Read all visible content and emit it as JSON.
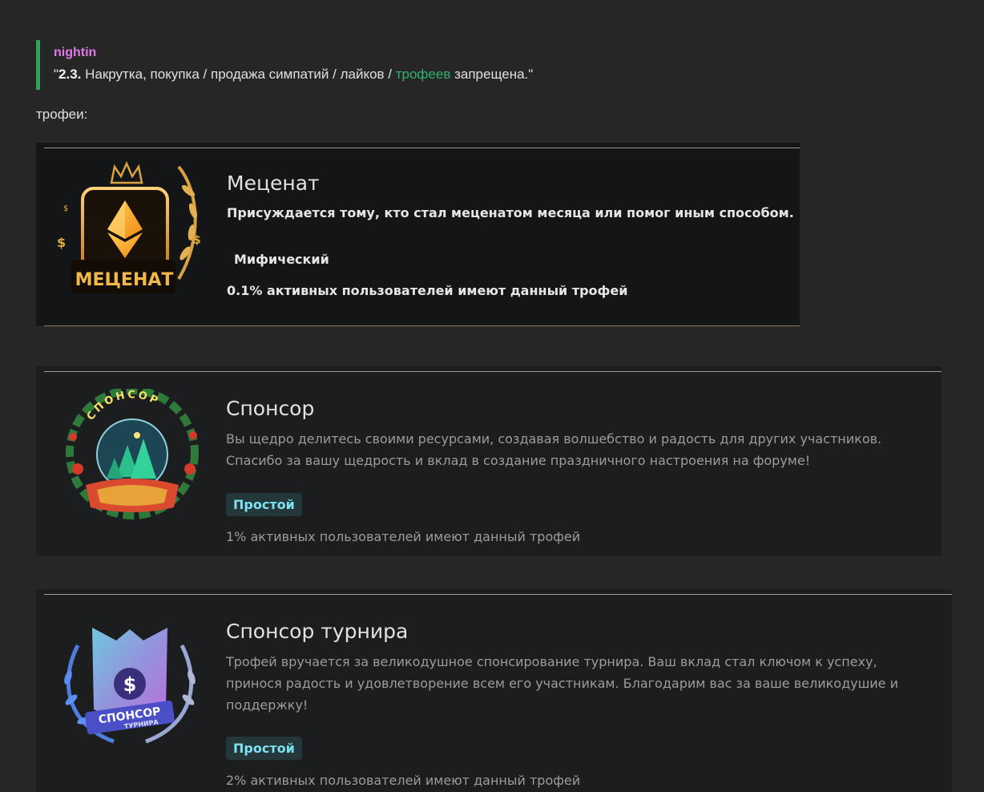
{
  "quote": {
    "author": "nightin",
    "open_quote": "\"",
    "rule_number": "2.3.",
    "text_before": " Накрутка, покупка / продажа симпатий / лайков / ",
    "link": "трофеев",
    "text_after": " запрещена.\""
  },
  "trophies_label": "трофеи:",
  "trophies": [
    {
      "title": "Меценат",
      "description": "Присуждается тому, кто стал меценатом месяца или помог иным способом.",
      "rarity": "Мифический",
      "stat": "0.1% активных пользователей имеют данный трофей",
      "badge_text": "МЕЦЕНАТ",
      "icon": "patron-trophy-icon"
    },
    {
      "title": "Спонсор",
      "description_line1": "Вы щедро делитесь своими ресурсами, создавая волшебство и радость для других участников.",
      "description_line2": "Спасибо за вашу щедрость и вклад в создание праздничного настроения на форуме!",
      "rarity": "Простой",
      "stat": "1% активных пользователей имеют данный трофей",
      "badge_text": "СПОНСОР",
      "icon": "sponsor-trophy-icon"
    },
    {
      "title": "Спонсор турнира",
      "description_line1": "Трофей вручается за великодушное спонсирование турнира. Ваш вклад стал ключом к успеху,",
      "description_line2": "принося радость и удовлетворение всем его участникам. Благодарим вас за ваше великодушие и",
      "description_line3": "поддержку!",
      "rarity": "Простой",
      "stat": "2% активных пользователей имеют данный трофей",
      "badge_text": "СПОНСОР",
      "badge_subtext": "ТУРНИРА",
      "icon": "tournament-sponsor-trophy-icon"
    }
  ],
  "colors": {
    "background": "#262626",
    "quote_border": "#2ea35a",
    "author": "#e07ae6",
    "link": "#30b36a",
    "simple_badge": "#7fe0ef"
  }
}
